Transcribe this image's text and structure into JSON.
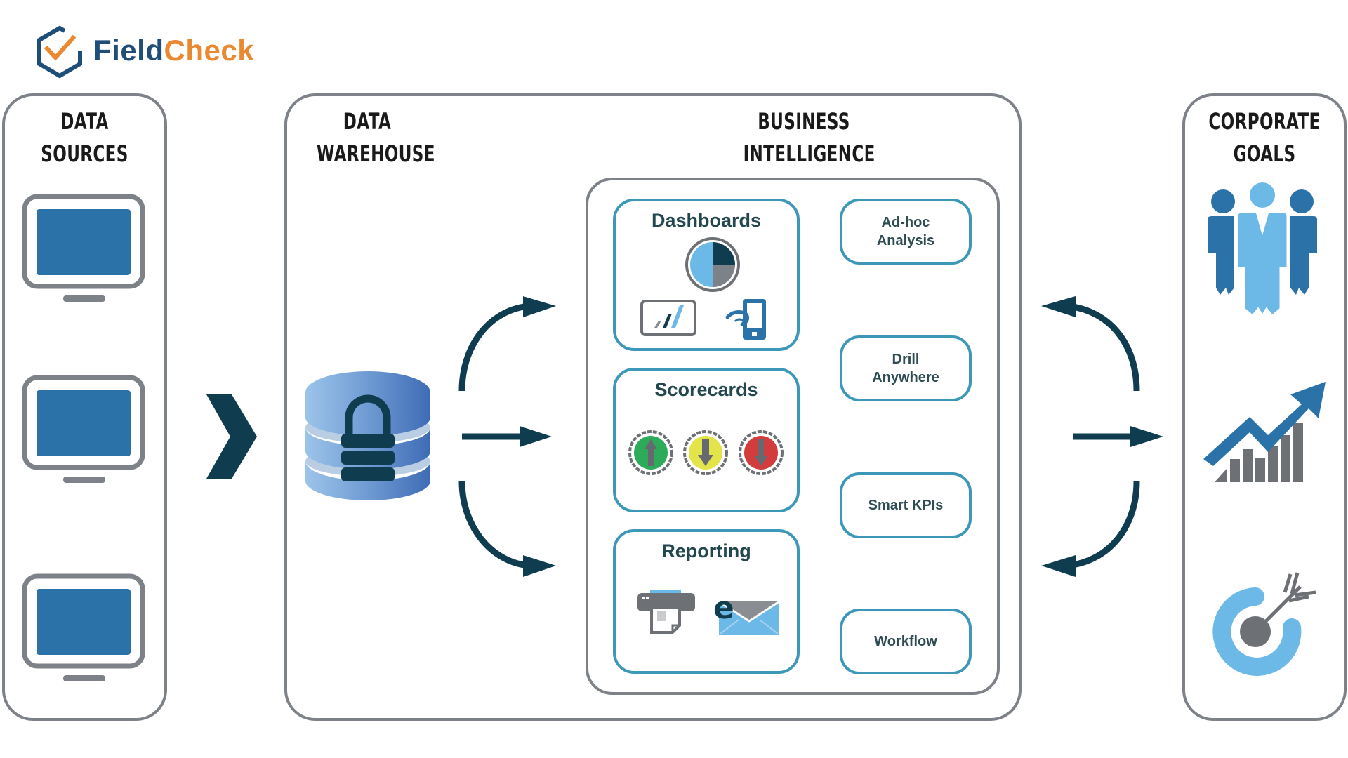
{
  "brand": {
    "name_part1": "Field",
    "name_part2": "Check",
    "primary_color": "#1f4e79",
    "accent_color": "#e98a33"
  },
  "columns": {
    "data_sources": {
      "title_line1": "DATA",
      "title_line2": "SOURCES",
      "icons": [
        "monitor-icon",
        "monitor-icon",
        "monitor-icon"
      ]
    },
    "data_warehouse": {
      "title_line1": "DATA",
      "title_line2": "WAREHOUSE",
      "icon": "locked-database-icon"
    },
    "business_intelligence": {
      "title_line1": "BUSINESS",
      "title_line2": "INTELLIGENCE",
      "cards": [
        {
          "label": "Dashboards",
          "icons": [
            "pie-chart-icon",
            "bar-chart-icon",
            "mobile-touch-icon"
          ]
        },
        {
          "label": "Scorecards",
          "icons": [
            "status-up-green-icon",
            "status-down-yellow-icon",
            "status-down-red-icon"
          ]
        },
        {
          "label": "Reporting",
          "icons": [
            "printer-icon",
            "email-icon"
          ]
        }
      ],
      "chips": [
        {
          "label": "Ad-hoc\nAnalysis"
        },
        {
          "label": "Drill\nAnywhere"
        },
        {
          "label": "Smart KPIs"
        },
        {
          "label": "Workflow"
        }
      ]
    },
    "corporate_goals": {
      "title_line1": "CORPORATE",
      "title_line2": "GOALS",
      "icons": [
        "team-icon",
        "growth-chart-icon",
        "target-icon"
      ]
    }
  },
  "colors": {
    "arrow": "#0f3d4f",
    "panel_border": "#7d8289",
    "card_border": "#3d97b8",
    "monitor_screen": "#2a72a8",
    "light_blue": "#6cb8e6",
    "mid_blue": "#2a72a8",
    "gray": "#74777c",
    "green": "#2eab5a",
    "yellow": "#e3e34a",
    "red": "#d23c3c"
  }
}
